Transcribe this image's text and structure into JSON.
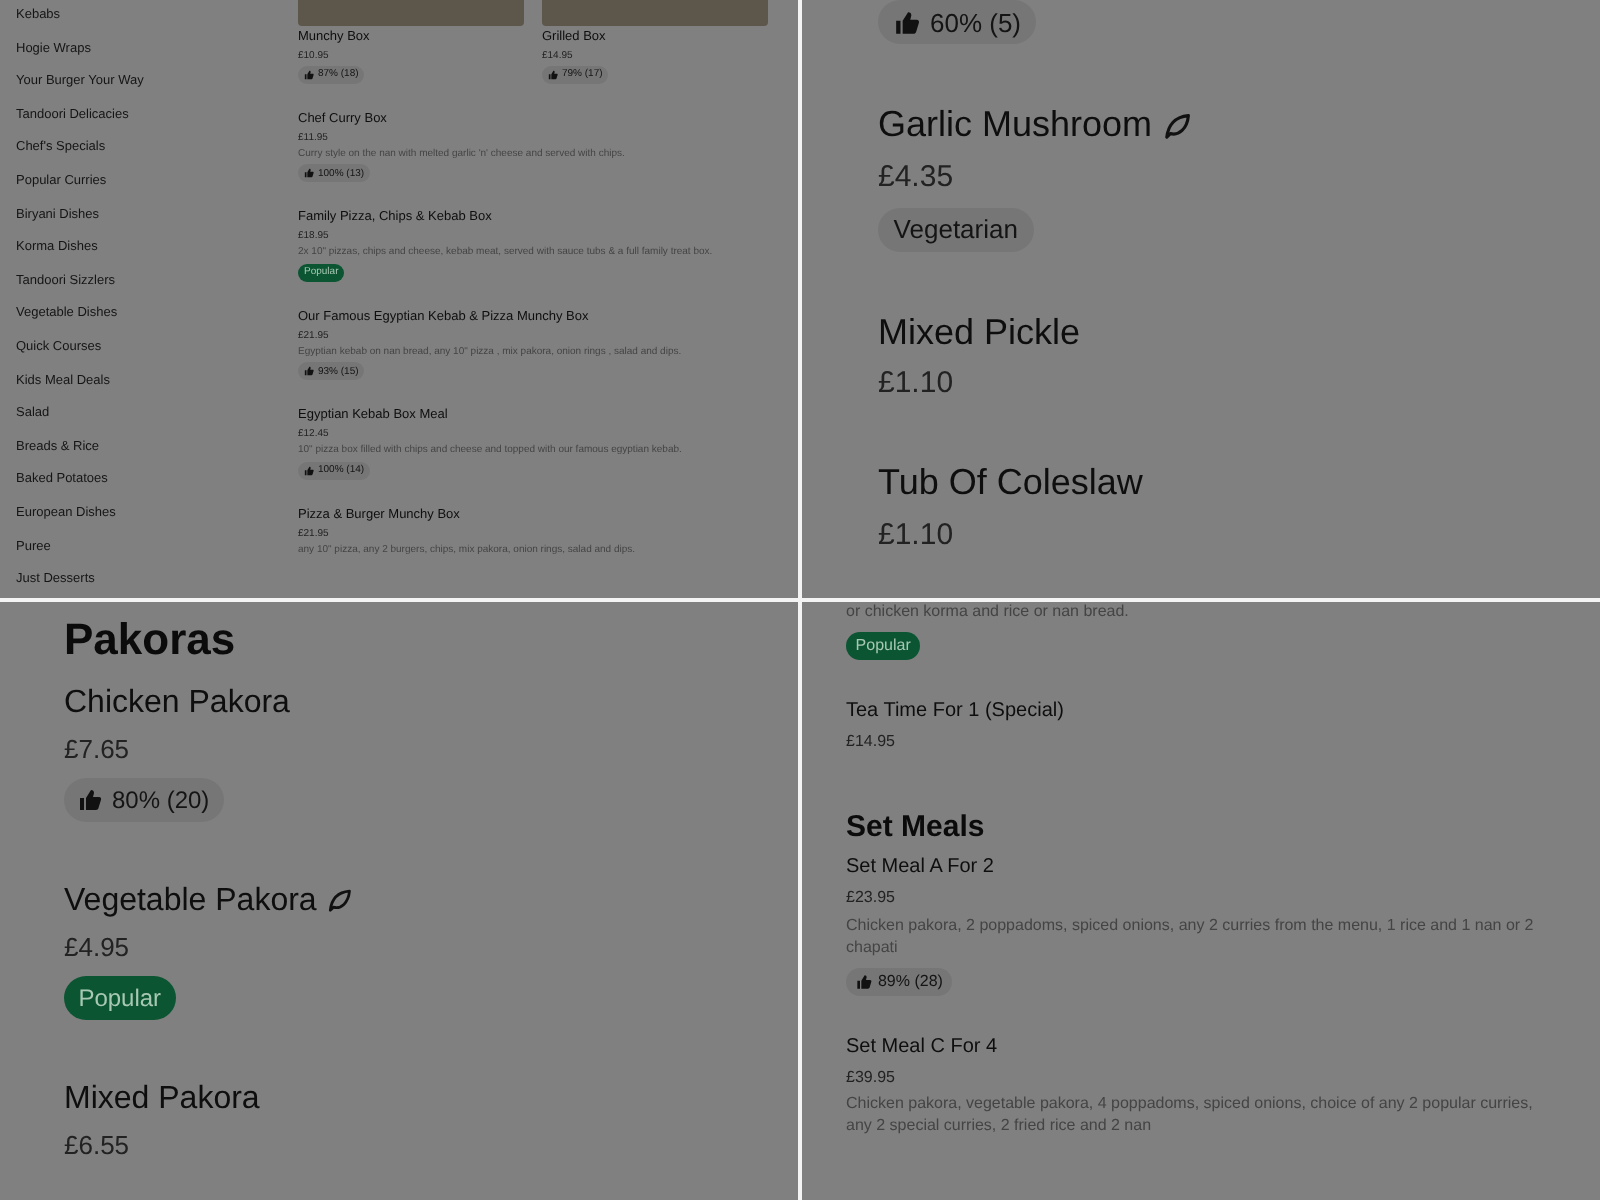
{
  "panels": [
    {
      "sidebar": {
        "items": [
          "Kebabs",
          "Hogie Wraps",
          "Your Burger Your Way",
          "Tandoori Delicacies",
          "Chef's Specials",
          "Popular Curries",
          "Biryani Dishes",
          "Korma Dishes",
          "Tandoori Sizzlers",
          "Vegetable Dishes",
          "Quick Courses",
          "Kids Meal Deals",
          "Salad",
          "Breads & Rice",
          "Baked Potatoes",
          "European Dishes",
          "Puree",
          "Just Desserts"
        ]
      },
      "cards": [
        {
          "name": "Munchy Box",
          "price": "£10.95",
          "rating": "87% (18)"
        },
        {
          "name": "Grilled Box",
          "price": "£14.95",
          "rating": "79% (17)"
        }
      ],
      "sections": [
        {
          "items": [
            {
              "name": "Chef Curry Box",
              "price": "£11.95",
              "description": "Curry style on the nan with melted garlic 'n' cheese and served with chips.",
              "rating": "100% (13)"
            },
            {
              "name": "Family Pizza, Chips & Kebab Box",
              "price": "£18.95",
              "description": "2x 10\" pizzas, chips and cheese, kebab meat, served with sauce tubs & a full family treat box.",
              "badges": [
                {
                  "kind": "popular",
                  "label": "Popular"
                }
              ]
            },
            {
              "name": "Our Famous Egyptian Kebab & Pizza Munchy Box",
              "price": "£21.95",
              "description": "Egyptian kebab on nan bread, any 10\" pizza , mix pakora, onion rings , salad and dips.",
              "rating": "93% (15)"
            },
            {
              "name": "Egyptian Kebab Box Meal",
              "price": "£12.45",
              "description": "10\" pizza box filled with chips and cheese and topped with our famous egyptian kebab.",
              "rating": "100% (14)"
            },
            {
              "name": "Pizza & Burger Munchy Box",
              "price": "£21.95",
              "description": "any 10\" pizza, any 2 burgers, chips, mix pakora, onion rings, salad and dips."
            }
          ]
        }
      ]
    },
    {
      "sections": [
        {
          "items": [
            {
              "rating": "60% (5)"
            },
            {
              "name": "Garlic Mushroom",
              "vegetarian_icon": true,
              "price": "£4.35",
              "badges": [
                {
                  "kind": "vegetarian",
                  "label": "Vegetarian"
                }
              ]
            },
            {
              "name": "Mixed Pickle",
              "price": "£1.10"
            },
            {
              "name": "Tub Of Coleslaw",
              "price": "£1.10"
            }
          ]
        }
      ]
    },
    {
      "sections": [
        {
          "heading": "Pakoras",
          "items": [
            {
              "name": "Chicken Pakora",
              "price": "£7.65",
              "rating": "80% (20)"
            },
            {
              "name": "Vegetable Pakora",
              "vegetarian_icon": true,
              "price": "£4.95",
              "badges": [
                {
                  "kind": "popular",
                  "label": "Popular"
                }
              ]
            },
            {
              "name": "Mixed Pakora",
              "price": "£6.55"
            }
          ]
        }
      ]
    },
    {
      "sections": [
        {
          "items": [
            {
              "description": "or chicken korma and rice or nan bread.",
              "badges": [
                {
                  "kind": "popular",
                  "label": "Popular"
                }
              ]
            },
            {
              "name": "Tea Time For 1 (Special)",
              "price": "£14.95"
            }
          ]
        },
        {
          "heading": "Set Meals",
          "items": [
            {
              "name": "Set Meal A For 2",
              "price": "£23.95",
              "description": "Chicken pakora, 2 poppadoms, spiced onions, any 2 curries from the menu, 1 rice and 1 nan or 2 chapati",
              "rating": "89% (28)"
            },
            {
              "name": "Set Meal C For 4",
              "price": "£39.95",
              "description": "Chicken pakora, vegetable pakora, 4 poppadoms, spiced onions, choice of any 2 popular curries, any 2 special curries, 2 fried rice and 2 nan"
            }
          ]
        }
      ]
    }
  ]
}
